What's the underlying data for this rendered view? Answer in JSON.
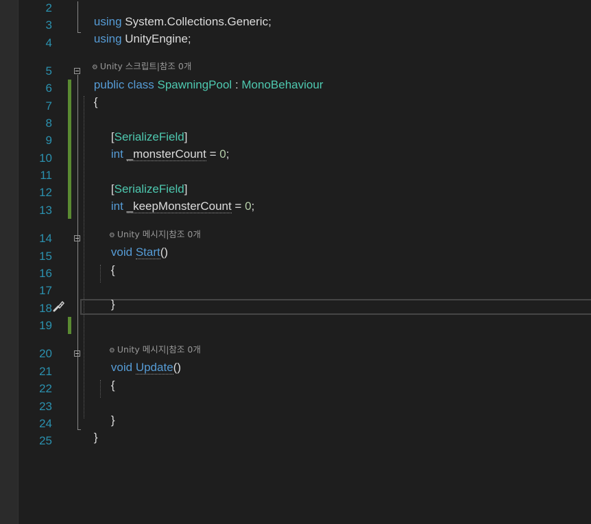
{
  "editor": {
    "line_numbers": [
      "2",
      "3",
      "4",
      "5",
      "6",
      "7",
      "8",
      "9",
      "10",
      "11",
      "12",
      "13",
      "14",
      "15",
      "16",
      "17",
      "18",
      "19",
      "20",
      "21",
      "22",
      "23",
      "24",
      "25"
    ],
    "codelens": {
      "class": "Unity 스크립트|참조 0개",
      "start": "Unity 메시지|참조 0개",
      "update": "Unity 메시지|참조 0개"
    },
    "code": {
      "using1_kw": "using",
      "using1_rest": " System.Collections.Generic;",
      "using2_kw": "using",
      "using2_rest": " UnityEngine;",
      "class_public": "public",
      "class_class": " class ",
      "class_name": "SpawningPool",
      "class_colon": " : ",
      "class_base": "MonoBehaviour",
      "open_brace": "{",
      "close_brace": "}",
      "attr_open": "[",
      "attr_name": "SerializeField",
      "attr_close": "]",
      "int_kw": "int",
      "field1_pre": " ",
      "field1_name": "_monsterCount",
      "field1_eq": " = ",
      "field1_val": "0",
      "semicolon": ";",
      "field2_name": "_keepMonsterCount",
      "void_kw": "void",
      "start_name": "Start",
      "update_name": "Update",
      "parens": "()"
    },
    "icons": {
      "codelens_marker": "⚙",
      "quick_action": "brush-icon"
    },
    "colors": {
      "background": "#1e1e1e",
      "line_number": "#2b91af",
      "keyword": "#569cd6",
      "type": "#4ec9b0",
      "number": "#b5cea8",
      "text": "#dcdcdc",
      "change_bar": "#5a8a32"
    }
  }
}
